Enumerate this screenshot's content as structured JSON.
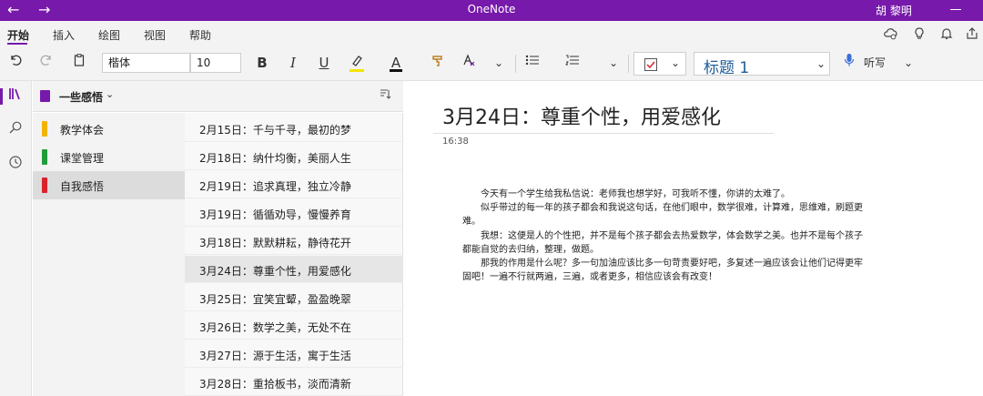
{
  "titlebar": {
    "app_title": "OneNote",
    "user_name": "胡 黎明",
    "back_icon": "←",
    "forward_icon": "→"
  },
  "menu": {
    "tabs": [
      "开始",
      "插入",
      "绘图",
      "视图",
      "帮助"
    ],
    "active_tab": "开始"
  },
  "toolbar": {
    "font_name": "楷体",
    "font_size": "10",
    "bold": "B",
    "italic": "I",
    "underline": "U",
    "font_color_letter": "A",
    "style_value": "标题 1",
    "dictate_label": "听写",
    "highlight_color": "#f5e400",
    "font_color": "#111111"
  },
  "notebook": {
    "name": "一些感悟",
    "color": "#7719aa"
  },
  "sections": [
    {
      "label": "教学体会",
      "color": "#f2b400",
      "selected": false
    },
    {
      "label": "课堂管理",
      "color": "#1f9d3a",
      "selected": false
    },
    {
      "label": "自我感悟",
      "color": "#d8232a",
      "selected": true
    }
  ],
  "pages": [
    {
      "label": "2月15日：千与千寻，最初的梦",
      "selected": false
    },
    {
      "label": "2月18日：纳什均衡，美丽人生",
      "selected": false
    },
    {
      "label": "2月19日：追求真理，独立冷静",
      "selected": false
    },
    {
      "label": "3月19日：循循劝导，慢慢养育",
      "selected": false
    },
    {
      "label": "3月18日：默默耕耘，静待花开",
      "selected": false
    },
    {
      "label": "3月24日：尊重个性，用爱感化",
      "selected": true
    },
    {
      "label": "3月25日：宜笑宜颦，盈盈晚翠",
      "selected": false
    },
    {
      "label": "3月26日：数学之美，无处不在",
      "selected": false
    },
    {
      "label": "3月27日：源于生活，寓于生活",
      "selected": false
    },
    {
      "label": "3月28日：重拾板书，淡而清新",
      "selected": false
    }
  ],
  "page": {
    "title": "3月24日：尊重个性，用爱感化",
    "time": "16:38",
    "paragraphs": [
      "　　今天有一个学生给我私信说：老师我也想学好，可我听不懂，你讲的太难了。",
      "　　似乎带过的每一年的孩子都会和我说这句话，在他们眼中，数学很难，计算难，思维难，刷题更难。",
      "　　我想：这便是人的个性把，并不是每个孩子都会去热爱数学，体会数学之美。也并不是每个孩子都能自觉的去归纳，整理，做题。",
      "　　那我的作用是什么呢？多一句加油应该比多一句苛责要好吧，多复述一遍应该会让他们记得更牢固吧！一遍不行就两遍，三遍，或者更多，相信应该会有改变！"
    ]
  }
}
